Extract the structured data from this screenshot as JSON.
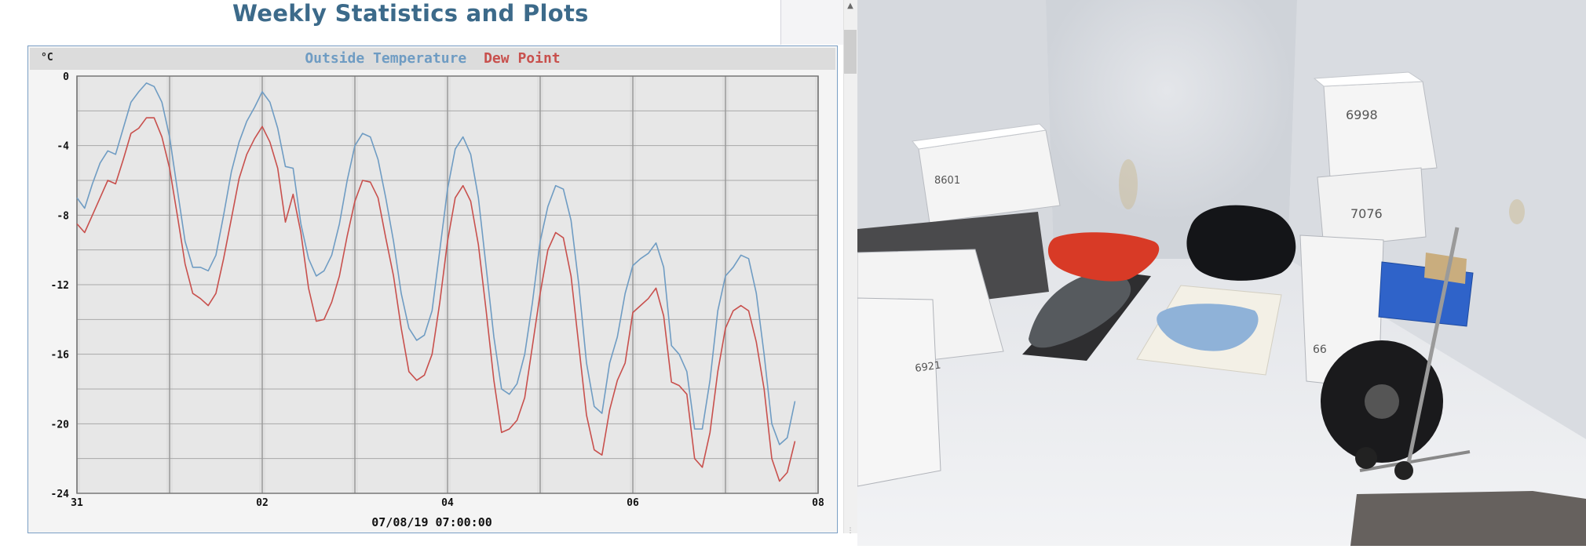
{
  "page": {
    "title": "Weekly Statistics and Plots"
  },
  "chart_data": {
    "type": "line",
    "title_parts": [
      {
        "text": "Outside Temperature",
        "color": "#6f9cc3"
      },
      {
        "text": "Dew Point",
        "color": "#c8504d"
      }
    ],
    "unit_label": "°C",
    "xlabel": "07/08/19 07:00:00",
    "x_unit": "hours from tick \"31\"",
    "x_ticks": [
      {
        "x": 0,
        "label": "31"
      },
      {
        "x": 48,
        "label": "02"
      },
      {
        "x": 96,
        "label": "04"
      },
      {
        "x": 144,
        "label": "06"
      },
      {
        "x": 192,
        "label": "08"
      }
    ],
    "xlim": [
      0,
      192
    ],
    "ylim": [
      -24,
      0
    ],
    "y_ticks": [
      0,
      -4,
      -8,
      -12,
      -16,
      -20,
      -24
    ],
    "grid": true,
    "series": [
      {
        "name": "Outside Temperature",
        "color": "#6f9cc3",
        "points": [
          [
            0,
            -7.0
          ],
          [
            2,
            -7.6
          ],
          [
            4,
            -6.2
          ],
          [
            6,
            -5.0
          ],
          [
            8,
            -4.3
          ],
          [
            10,
            -4.5
          ],
          [
            12,
            -3.0
          ],
          [
            14,
            -1.5
          ],
          [
            16,
            -0.9
          ],
          [
            18,
            -0.4
          ],
          [
            20,
            -0.6
          ],
          [
            22,
            -1.5
          ],
          [
            24,
            -3.5
          ],
          [
            26,
            -6.5
          ],
          [
            28,
            -9.5
          ],
          [
            30,
            -11.0
          ],
          [
            32,
            -11.0
          ],
          [
            34,
            -11.2
          ],
          [
            36,
            -10.3
          ],
          [
            38,
            -8.0
          ],
          [
            40,
            -5.5
          ],
          [
            42,
            -3.8
          ],
          [
            44,
            -2.6
          ],
          [
            46,
            -1.8
          ],
          [
            48,
            -0.9
          ],
          [
            50,
            -1.5
          ],
          [
            52,
            -3.0
          ],
          [
            54,
            -5.2
          ],
          [
            56,
            -5.3
          ],
          [
            58,
            -8.5
          ],
          [
            60,
            -10.5
          ],
          [
            62,
            -11.5
          ],
          [
            64,
            -11.2
          ],
          [
            66,
            -10.3
          ],
          [
            68,
            -8.5
          ],
          [
            70,
            -6.0
          ],
          [
            72,
            -4.0
          ],
          [
            74,
            -3.3
          ],
          [
            76,
            -3.5
          ],
          [
            78,
            -4.8
          ],
          [
            80,
            -7.0
          ],
          [
            82,
            -9.5
          ],
          [
            84,
            -12.5
          ],
          [
            86,
            -14.5
          ],
          [
            88,
            -15.2
          ],
          [
            90,
            -14.9
          ],
          [
            92,
            -13.5
          ],
          [
            94,
            -10.0
          ],
          [
            96,
            -6.5
          ],
          [
            98,
            -4.2
          ],
          [
            100,
            -3.5
          ],
          [
            102,
            -4.5
          ],
          [
            104,
            -7.0
          ],
          [
            106,
            -11.0
          ],
          [
            108,
            -15.0
          ],
          [
            110,
            -18.0
          ],
          [
            112,
            -18.3
          ],
          [
            114,
            -17.7
          ],
          [
            116,
            -16.0
          ],
          [
            118,
            -13.0
          ],
          [
            120,
            -9.5
          ],
          [
            122,
            -7.5
          ],
          [
            124,
            -6.3
          ],
          [
            126,
            -6.5
          ],
          [
            128,
            -8.3
          ],
          [
            130,
            -12.0
          ],
          [
            132,
            -16.5
          ],
          [
            134,
            -19.0
          ],
          [
            136,
            -19.4
          ],
          [
            138,
            -16.5
          ],
          [
            140,
            -15.0
          ],
          [
            142,
            -12.5
          ],
          [
            144,
            -10.9
          ],
          [
            146,
            -10.5
          ],
          [
            148,
            -10.2
          ],
          [
            150,
            -9.6
          ],
          [
            152,
            -11.0
          ],
          [
            154,
            -15.5
          ],
          [
            156,
            -16.0
          ],
          [
            158,
            -17.0
          ],
          [
            160,
            -20.3
          ],
          [
            162,
            -20.3
          ],
          [
            164,
            -17.5
          ],
          [
            166,
            -13.5
          ],
          [
            168,
            -11.5
          ],
          [
            170,
            -11.0
          ],
          [
            172,
            -10.3
          ],
          [
            174,
            -10.5
          ],
          [
            176,
            -12.5
          ],
          [
            178,
            -16.0
          ],
          [
            180,
            -20.0
          ],
          [
            182,
            -21.2
          ],
          [
            184,
            -20.8
          ],
          [
            186,
            -18.7
          ]
        ]
      },
      {
        "name": "Dew Point",
        "color": "#c8504d",
        "points": [
          [
            0,
            -8.5
          ],
          [
            2,
            -9.0
          ],
          [
            4,
            -8.0
          ],
          [
            6,
            -7.0
          ],
          [
            8,
            -6.0
          ],
          [
            10,
            -6.2
          ],
          [
            12,
            -4.8
          ],
          [
            14,
            -3.3
          ],
          [
            16,
            -3.0
          ],
          [
            18,
            -2.4
          ],
          [
            20,
            -2.4
          ],
          [
            22,
            -3.5
          ],
          [
            24,
            -5.3
          ],
          [
            26,
            -8.0
          ],
          [
            28,
            -10.8
          ],
          [
            30,
            -12.5
          ],
          [
            32,
            -12.8
          ],
          [
            34,
            -13.2
          ],
          [
            36,
            -12.5
          ],
          [
            38,
            -10.5
          ],
          [
            40,
            -8.2
          ],
          [
            42,
            -5.9
          ],
          [
            44,
            -4.5
          ],
          [
            46,
            -3.6
          ],
          [
            48,
            -2.9
          ],
          [
            50,
            -3.8
          ],
          [
            52,
            -5.3
          ],
          [
            54,
            -8.4
          ],
          [
            56,
            -6.8
          ],
          [
            58,
            -9.0
          ],
          [
            60,
            -12.2
          ],
          [
            62,
            -14.1
          ],
          [
            64,
            -14.0
          ],
          [
            66,
            -13.0
          ],
          [
            68,
            -11.5
          ],
          [
            70,
            -9.2
          ],
          [
            72,
            -7.2
          ],
          [
            74,
            -6.0
          ],
          [
            76,
            -6.1
          ],
          [
            78,
            -7.0
          ],
          [
            80,
            -9.3
          ],
          [
            82,
            -11.5
          ],
          [
            84,
            -14.5
          ],
          [
            86,
            -17.0
          ],
          [
            88,
            -17.5
          ],
          [
            90,
            -17.2
          ],
          [
            92,
            -16.0
          ],
          [
            94,
            -13.0
          ],
          [
            96,
            -9.5
          ],
          [
            98,
            -7.0
          ],
          [
            100,
            -6.3
          ],
          [
            102,
            -7.2
          ],
          [
            104,
            -9.7
          ],
          [
            106,
            -13.5
          ],
          [
            108,
            -17.5
          ],
          [
            110,
            -20.5
          ],
          [
            112,
            -20.3
          ],
          [
            114,
            -19.8
          ],
          [
            116,
            -18.5
          ],
          [
            118,
            -15.5
          ],
          [
            120,
            -12.5
          ],
          [
            122,
            -10.0
          ],
          [
            124,
            -9.0
          ],
          [
            126,
            -9.3
          ],
          [
            128,
            -11.5
          ],
          [
            130,
            -15.5
          ],
          [
            132,
            -19.5
          ],
          [
            134,
            -21.5
          ],
          [
            136,
            -21.8
          ],
          [
            138,
            -19.2
          ],
          [
            140,
            -17.5
          ],
          [
            142,
            -16.5
          ],
          [
            144,
            -13.6
          ],
          [
            146,
            -13.2
          ],
          [
            148,
            -12.8
          ],
          [
            150,
            -12.2
          ],
          [
            152,
            -13.8
          ],
          [
            154,
            -17.6
          ],
          [
            156,
            -17.8
          ],
          [
            158,
            -18.3
          ],
          [
            160,
            -22.0
          ],
          [
            162,
            -22.5
          ],
          [
            164,
            -20.5
          ],
          [
            166,
            -17.0
          ],
          [
            168,
            -14.5
          ],
          [
            170,
            -13.5
          ],
          [
            172,
            -13.2
          ],
          [
            174,
            -13.5
          ],
          [
            176,
            -15.3
          ],
          [
            178,
            -18.0
          ],
          [
            180,
            -22.0
          ],
          [
            182,
            -23.3
          ],
          [
            184,
            -22.8
          ],
          [
            186,
            -21.0
          ]
        ]
      }
    ]
  },
  "photo": {
    "box_labels": [
      "6998",
      "7076",
      "8601",
      "6921",
      "66"
    ]
  },
  "colors": {
    "title": "#3c6a8a",
    "plot_bg": "#e0e0e0",
    "frame_border": "#7a9ec4"
  }
}
